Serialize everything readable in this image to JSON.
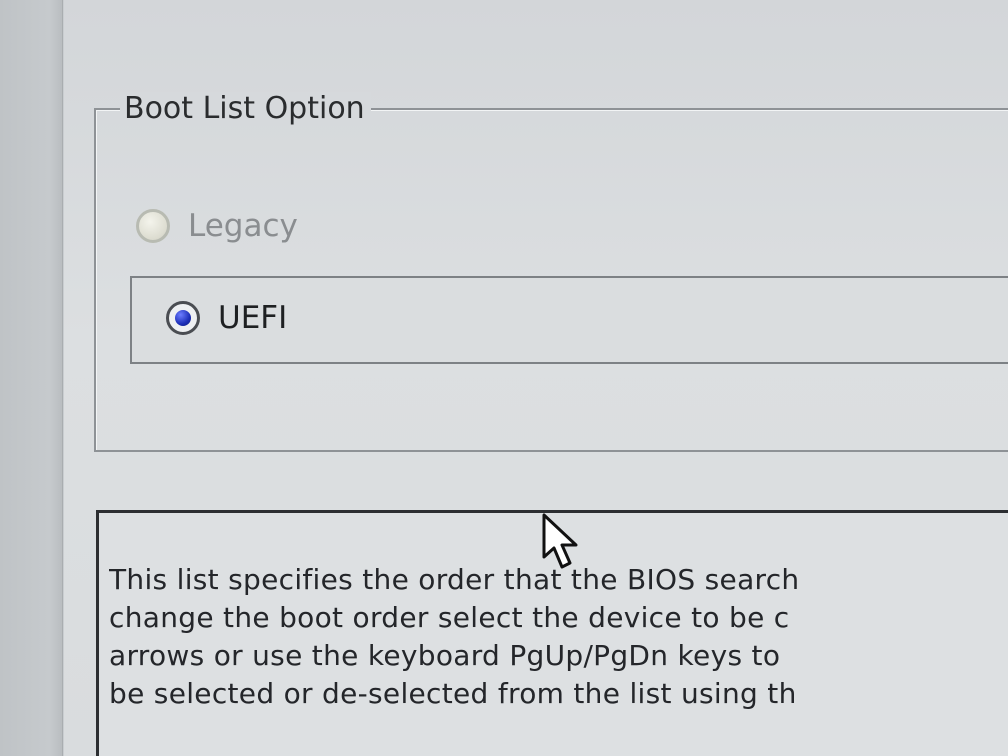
{
  "boot_list_option": {
    "title": "Boot List Option",
    "options": [
      {
        "label": "Legacy",
        "selected": false
      },
      {
        "label": "UEFI",
        "selected": true
      }
    ]
  },
  "help": {
    "lines": [
      "This list specifies the order that the BIOS search",
      "change the boot order select the device to be c",
      "arrows or use the keyboard PgUp/PgDn keys to",
      "be selected or de-selected from the list using th"
    ]
  },
  "icons": {
    "cursor": "mouse-pointer-icon",
    "radio_off": "radio-unselected-icon",
    "radio_on": "radio-selected-icon"
  },
  "colors": {
    "radio_selected_dot": "#1d2fb8",
    "panel_background": "#d9dcde"
  }
}
